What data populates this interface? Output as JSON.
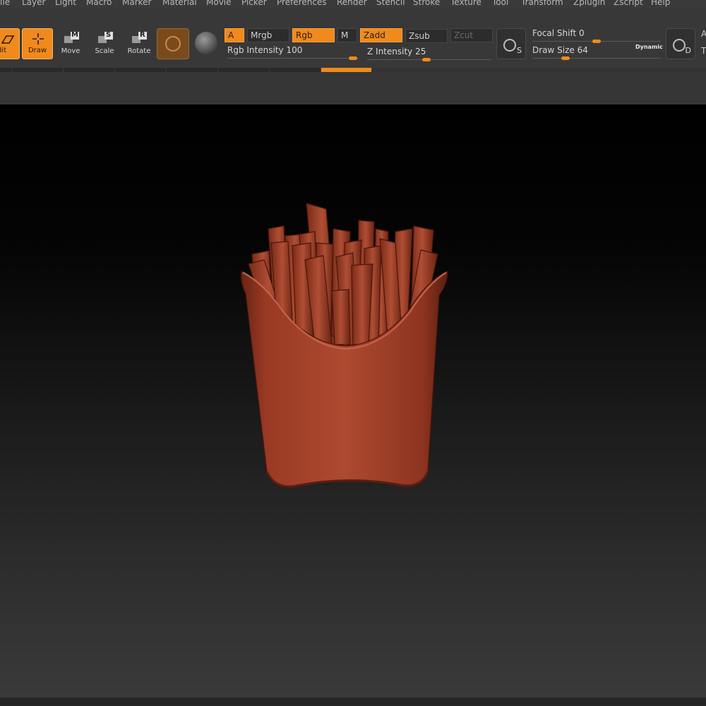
{
  "menu": [
    "File",
    "Layer",
    "Light",
    "Macro",
    "Marker",
    "Material",
    "Movie",
    "Picker",
    "Preferences",
    "Render",
    "Stencil",
    "Stroke",
    "Texture",
    "Tool",
    "Transform",
    "Zplugin",
    "Zscript",
    "Help"
  ],
  "tools": {
    "edit": "Edit",
    "draw": "Draw",
    "move": "Move",
    "scale": "Scale",
    "rotate": "Rotate",
    "move_key": "M",
    "scale_key": "S",
    "rotate_key": "R"
  },
  "modes": {
    "a": "A",
    "mrgb": "Mrgb",
    "rgb": "Rgb",
    "m": "M",
    "zadd": "Zadd",
    "zsub": "Zsub",
    "zcut": "Zcut"
  },
  "sliders": {
    "rgb_intensity_label": "Rgb Intensity",
    "rgb_intensity": "100",
    "z_intensity_label": "Z Intensity",
    "z_intensity": "25",
    "focal_shift_label": "Focal Shift",
    "focal_shift": "0",
    "draw_size_label": "Draw Size",
    "draw_size": "64",
    "dynamic_label": "Dynamic"
  },
  "brush_buttons": {
    "s_letter": "S",
    "d_letter": "D"
  },
  "right_edge": [
    "A",
    "T"
  ],
  "colors": {
    "accent": "#f08a1c",
    "model": "#a8442c"
  },
  "icons": [
    "draw-cursor-icon",
    "move-icon",
    "scale-icon",
    "rotate-icon",
    "material-icon",
    "sphere-icon",
    "brush-s-icon",
    "brush-d-icon"
  ]
}
